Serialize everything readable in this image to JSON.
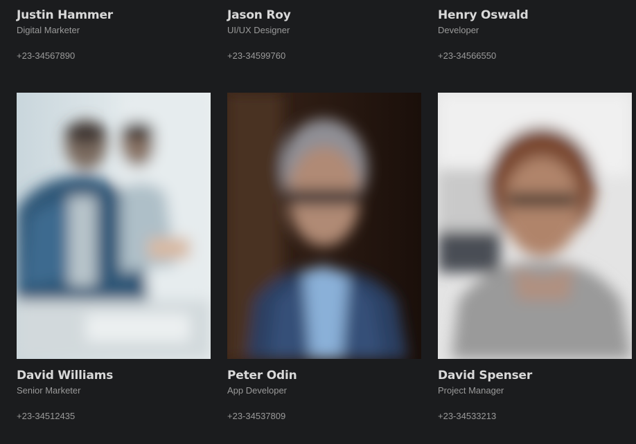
{
  "team_top": [
    {
      "name": "Justin Hammer",
      "role": "Digital Marketer",
      "phone": "+23-34567890"
    },
    {
      "name": "Jason Roy",
      "role": "UI/UX Designer",
      "phone": "+23-34599760"
    },
    {
      "name": "Henry Oswald",
      "role": "Developer",
      "phone": "+23-34566550"
    }
  ],
  "team_bottom": [
    {
      "name": "David Williams",
      "role": "Senior Marketer",
      "phone": "+23-34512435"
    },
    {
      "name": "Peter Odin",
      "role": "App Developer",
      "phone": "+23-34537809"
    },
    {
      "name": "David Spenser",
      "role": "Project Manager",
      "phone": "+23-34533213"
    }
  ],
  "colors": {
    "background": "#1b1c1e",
    "name_text": "#d9d9d9",
    "secondary_text": "#9a9a9a"
  }
}
